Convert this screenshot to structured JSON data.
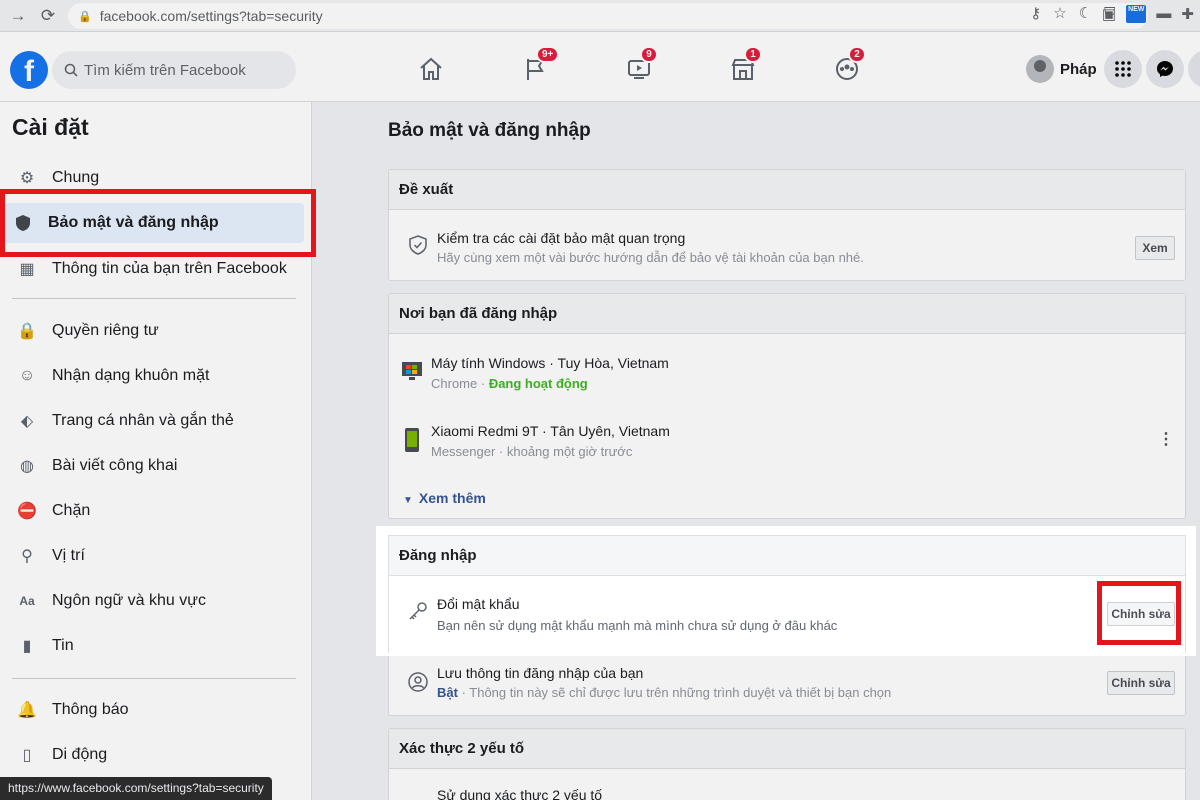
{
  "browser": {
    "url": "facebook.com/settings?tab=security",
    "new_label": "NEW"
  },
  "header": {
    "search_placeholder": "Tìm kiếm trên Facebook",
    "badges": {
      "pages": "9+",
      "watch": "9",
      "marketplace": "1",
      "groups": "2"
    },
    "profile_name": "Pháp"
  },
  "sidebar": {
    "title": "Cài đặt",
    "items": [
      {
        "label": "Chung",
        "icon": "gear-icon"
      },
      {
        "label": "Bảo mật và đăng nhập",
        "icon": "shield-icon"
      },
      {
        "label": "Thông tin của bạn trên Facebook",
        "icon": "grid-icon"
      },
      {
        "label": "Quyền riêng tư",
        "icon": "lock-icon"
      },
      {
        "label": "Nhận dạng khuôn mặt",
        "icon": "face-icon"
      },
      {
        "label": "Trang cá nhân và gắn thẻ",
        "icon": "tag-icon"
      },
      {
        "label": "Bài viết công khai",
        "icon": "globe-icon"
      },
      {
        "label": "Chặn",
        "icon": "block-user-icon"
      },
      {
        "label": "Vị trí",
        "icon": "location-icon"
      },
      {
        "label": "Ngôn ngữ và khu vực",
        "icon": "language-icon"
      },
      {
        "label": "Tin",
        "icon": "stories-icon"
      },
      {
        "label": "Thông báo",
        "icon": "bell-icon"
      },
      {
        "label": "Di động",
        "icon": "mobile-icon"
      }
    ]
  },
  "main": {
    "title": "Bảo mật và đăng nhập",
    "suggest": {
      "header": "Đề xuất",
      "item_title": "Kiểm tra các cài đặt bảo mật quan trọng",
      "item_sub": "Hãy cùng xem một vài bước hướng dẫn để bảo vệ tài khoản của bạn nhé.",
      "button": "Xem"
    },
    "where": {
      "header": "Nơi bạn đã đăng nhập",
      "devices": [
        {
          "title": "Máy tính Windows · Tuy Hòa, Vietnam",
          "app": "Chrome",
          "sep": " · ",
          "status": "Đang hoạt động"
        },
        {
          "title": "Xiaomi Redmi 9T · Tân Uyên, Vietnam",
          "sub": "Messenger · khoảng một giờ trước"
        }
      ],
      "see_more": "Xem thêm"
    },
    "login": {
      "header": "Đăng nhập",
      "change_pw_title": "Đổi mật khẩu",
      "change_pw_sub": "Bạn nên sử dụng mật khẩu mạnh mà mình chưa sử dụng ở đâu khác",
      "edit_button": "Chỉnh sửa",
      "save_login_title": "Lưu thông tin đăng nhập của bạn",
      "save_login_on": "Bật",
      "save_login_sub": " · Thông tin này sẽ chỉ được lưu trên những trình duyệt và thiết bị bạn chọn",
      "edit_button_2": "Chỉnh sửa"
    },
    "twofa": {
      "header": "Xác thực 2 yếu tố",
      "partial": "Sử dụng xác thực 2 yếu tố"
    }
  },
  "status_url": "https://www.facebook.com/settings?tab=security"
}
